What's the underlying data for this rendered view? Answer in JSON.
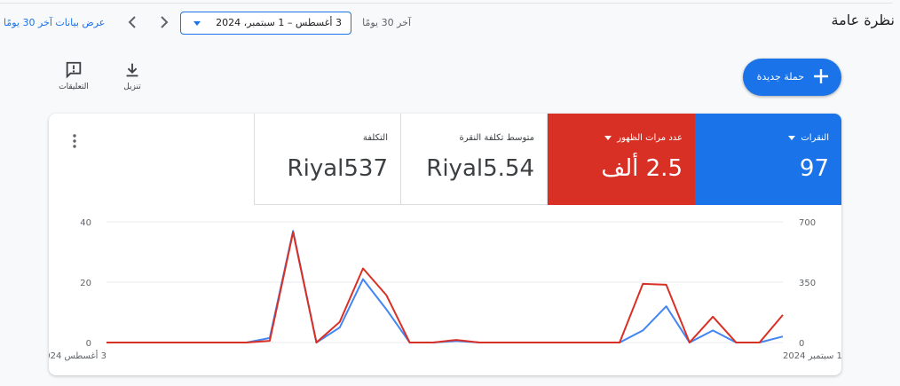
{
  "header": {
    "title": "نظرة عامة",
    "range_label": "آخر 30 يومًا",
    "date_range": "3 أغسطس – 1 سبتمبر، 2024",
    "view_all_link": "عرض بيانات آخر 30 يومًا"
  },
  "toolbar": {
    "download_label": "تنزيل",
    "comments_label": "التعليقات",
    "new_campaign_label": "حملة جديدة"
  },
  "metrics": [
    {
      "key": "clicks",
      "label": "النقرات",
      "value": "97",
      "has_dropdown": true,
      "color": "#1a73e8"
    },
    {
      "key": "impressions",
      "label": "عدد مرات الظهور",
      "value": "2.5 ألف",
      "has_dropdown": true,
      "color": "#d93025"
    },
    {
      "key": "avg_cpc",
      "label": "متوسط تكلفة النقرة",
      "value": "Riyal5.54",
      "has_dropdown": false
    },
    {
      "key": "cost",
      "label": "التكلفة",
      "value": "Riyal537",
      "has_dropdown": false
    }
  ],
  "chart_data": {
    "type": "line",
    "x": [
      "Aug 3",
      "Aug 4",
      "Aug 5",
      "Aug 6",
      "Aug 7",
      "Aug 8",
      "Aug 9",
      "Aug 10",
      "Aug 11",
      "Aug 12",
      "Aug 13",
      "Aug 14",
      "Aug 15",
      "Aug 16",
      "Aug 17",
      "Aug 18",
      "Aug 19",
      "Aug 20",
      "Aug 21",
      "Aug 22",
      "Aug 23",
      "Aug 24",
      "Aug 25",
      "Aug 26",
      "Aug 27",
      "Aug 28",
      "Aug 29",
      "Aug 30",
      "Aug 31",
      "Sep 1"
    ],
    "x_tick_labels": {
      "first": "3 أغسطس 2024",
      "last": "1 سبتمبر 2024"
    },
    "series": [
      {
        "name": "النقرات",
        "axis": "left",
        "color": "#4285f4",
        "values": [
          0,
          0,
          0,
          0,
          0,
          0,
          0,
          1.5,
          37,
          0,
          5,
          21,
          11,
          0,
          0,
          0.5,
          0,
          0,
          0,
          0,
          0,
          0,
          0,
          4,
          12,
          0,
          4,
          0,
          0,
          2
        ]
      },
      {
        "name": "عدد مرات الظهور",
        "axis": "right",
        "color": "#d93025",
        "values": [
          0,
          0,
          0,
          0,
          0,
          0,
          0,
          10,
          640,
          0,
          120,
          430,
          275,
          0,
          0,
          15,
          0,
          0,
          0,
          0,
          0,
          0,
          0,
          340,
          335,
          0,
          150,
          0,
          0,
          160
        ]
      }
    ],
    "y_left": {
      "ticks": [
        "0",
        "20",
        "40"
      ],
      "lim": [
        0,
        40
      ]
    },
    "y_right": {
      "ticks": [
        "0",
        "350",
        "700"
      ],
      "lim": [
        0,
        700
      ]
    },
    "grid": true
  }
}
